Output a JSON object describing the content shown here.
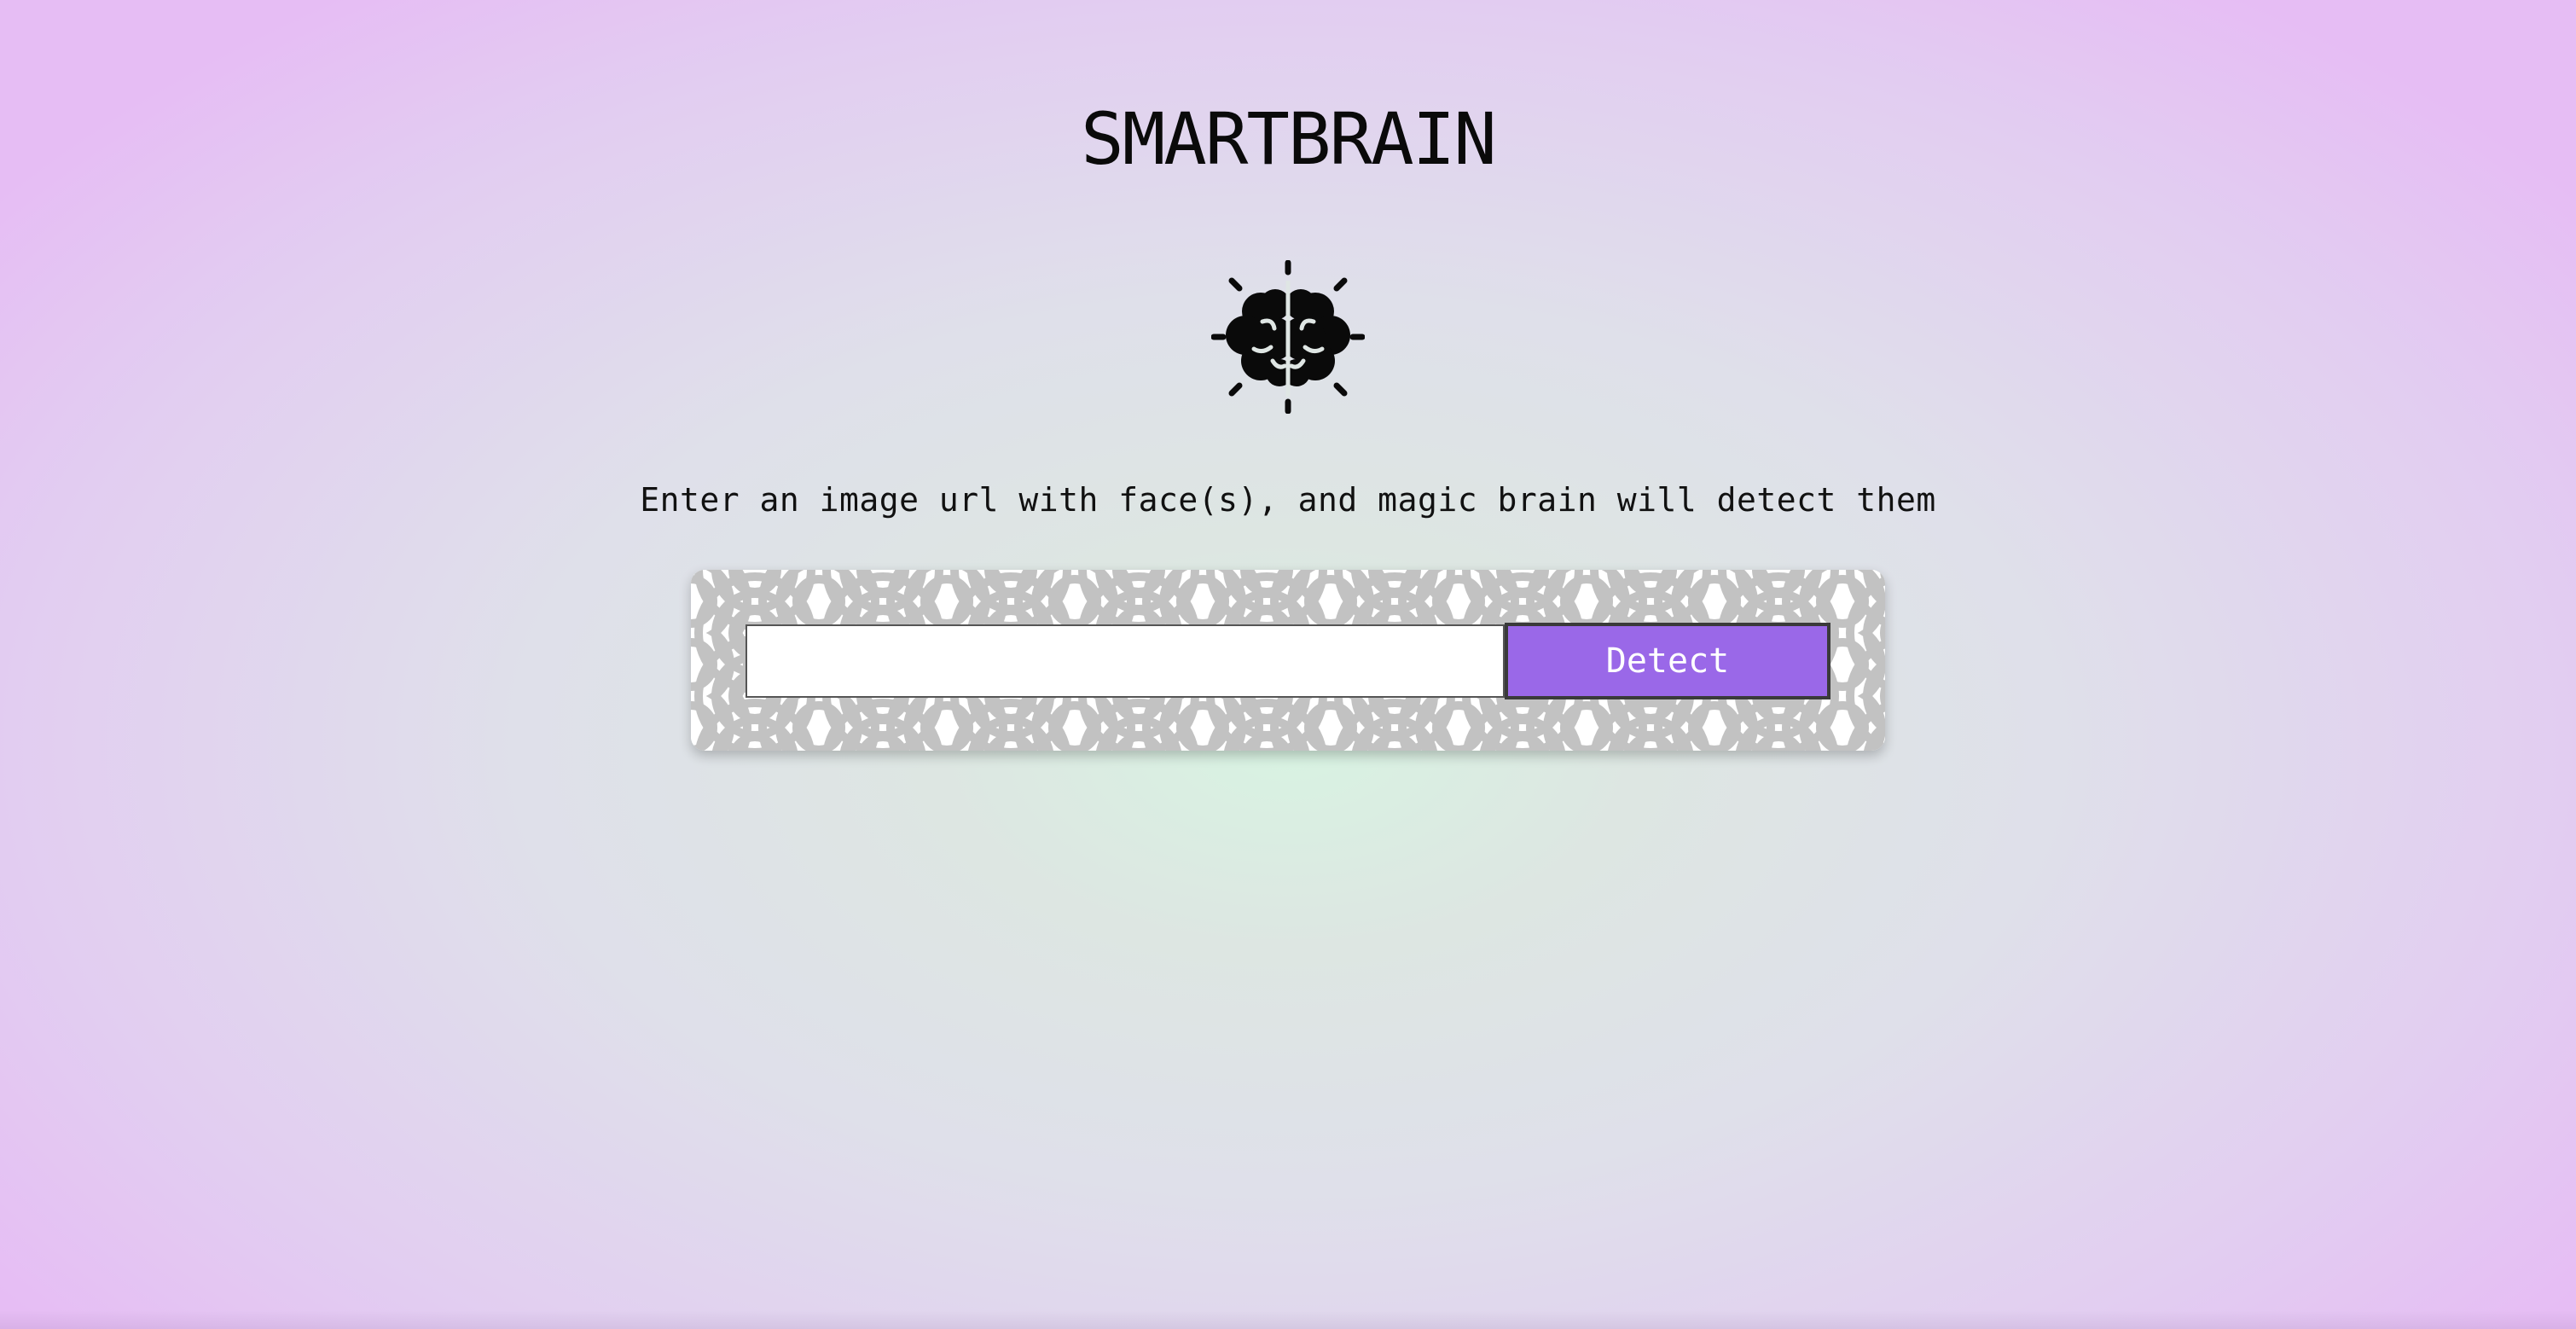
{
  "header": {
    "title": "SMARTBRAIN"
  },
  "logo": {
    "icon": "brain-icon"
  },
  "instructions": {
    "text": "Enter an image url with face(s), and magic brain will detect them"
  },
  "form": {
    "url_input_value": "",
    "url_input_placeholder": "",
    "detect_label": "Detect"
  },
  "colors": {
    "accent": "#9a68e8",
    "pattern": "#c2c2c2"
  }
}
